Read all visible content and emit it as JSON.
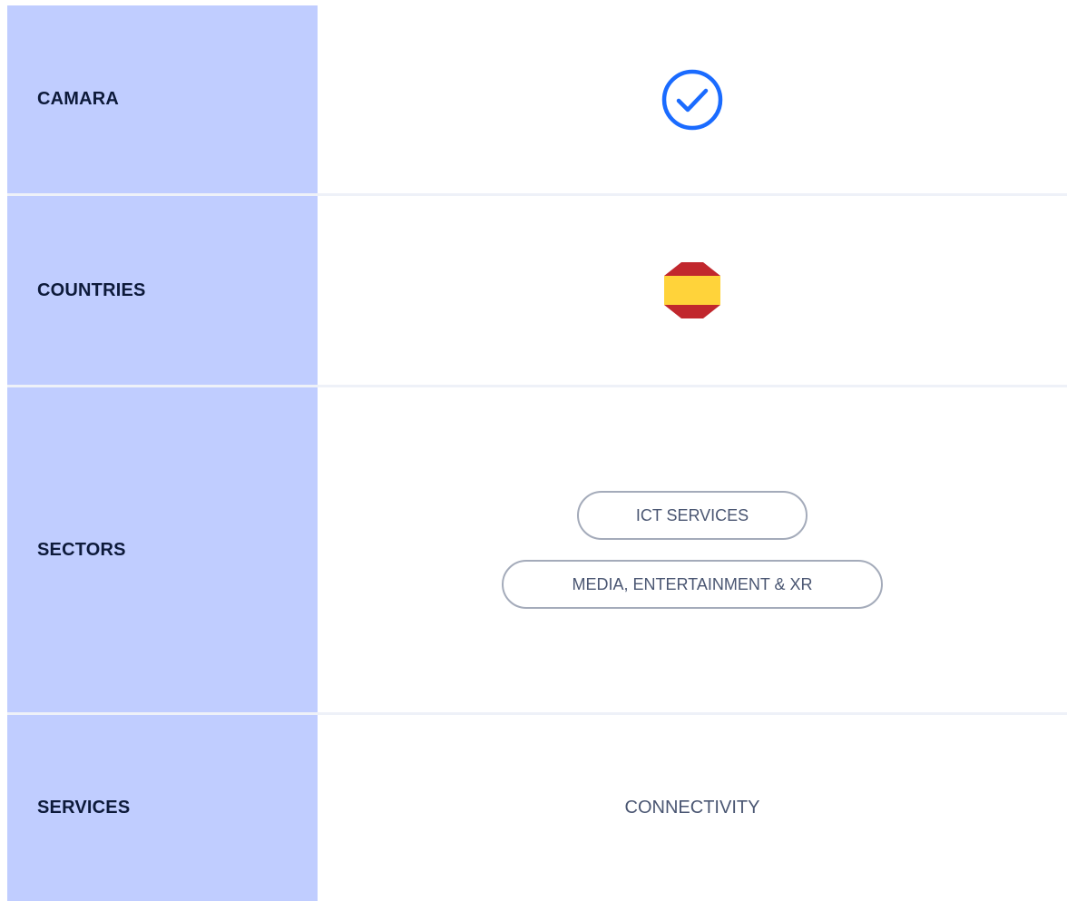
{
  "rows": {
    "camara": {
      "label": "CAMARA",
      "icon": "check-circle-icon",
      "accent": "#1a6bff"
    },
    "countries": {
      "label": "COUNTRIES",
      "icon": "spain-flag-icon",
      "flag_colors": [
        "#c1272d",
        "#ffd33a",
        "#c1272d"
      ]
    },
    "sectors": {
      "label": "SECTORS",
      "chips": [
        "ICT SERVICES",
        "MEDIA, ENTERTAINMENT & XR"
      ]
    },
    "services": {
      "label": "SERVICES",
      "value": "CONNECTIVITY"
    }
  },
  "colors": {
    "label_bg": "#c0cdff",
    "label_text": "#0d1a3a",
    "value_text": "#4a5672",
    "divider": "#eef1f8"
  }
}
